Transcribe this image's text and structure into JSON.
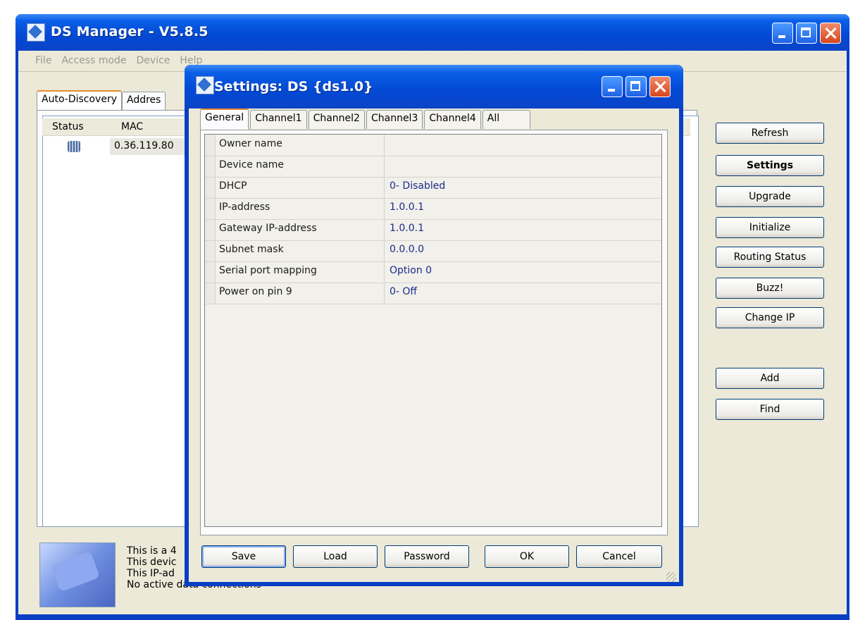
{
  "main_window": {
    "title": "DS Manager - V5.8.5",
    "menu": [
      "File",
      "Access mode",
      "Device",
      "Help"
    ],
    "tabs": [
      "Auto-Discovery",
      "Addres"
    ],
    "columns": [
      "Status",
      "MAC"
    ],
    "row": {
      "mac": "0.36.119.80"
    },
    "side_buttons": [
      "Refresh",
      "Settings",
      "Upgrade",
      "Initialize",
      "Routing Status",
      "Buzz!",
      "Change IP",
      "Add",
      "Find"
    ],
    "info_lines": [
      "This is a 4",
      "This devic",
      "This IP-ad",
      "No active data connections"
    ]
  },
  "dialog": {
    "title": "Settings: DS {ds1.0}",
    "tabs": [
      "General",
      "Channel1",
      "Channel2",
      "Channel3",
      "Channel4",
      "All"
    ],
    "settings": [
      {
        "name": "Owner name",
        "value": ""
      },
      {
        "name": "Device name",
        "value": ""
      },
      {
        "name": "DHCP",
        "value": "0- Disabled"
      },
      {
        "name": "IP-address",
        "value": "1.0.0.1"
      },
      {
        "name": "Gateway IP-address",
        "value": "1.0.0.1"
      },
      {
        "name": "Subnet mask",
        "value": "0.0.0.0"
      },
      {
        "name": "Serial port mapping",
        "value": "Option 0"
      },
      {
        "name": "Power on pin 9",
        "value": "0- Off"
      }
    ],
    "buttons": [
      "Save",
      "Load",
      "Password",
      "OK",
      "Cancel"
    ]
  },
  "colors": {
    "titlebar": "#0248d3",
    "face": "#ece9d8",
    "value_text": "#1b2a8a",
    "close": "#d8451c"
  }
}
